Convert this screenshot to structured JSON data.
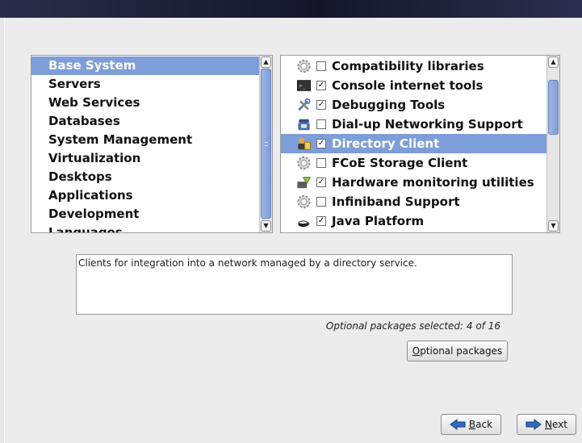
{
  "groups": {
    "items": [
      {
        "label": "Base System",
        "selected": true
      },
      {
        "label": "Servers"
      },
      {
        "label": "Web Services"
      },
      {
        "label": "Databases"
      },
      {
        "label": "System Management"
      },
      {
        "label": "Virtualization"
      },
      {
        "label": "Desktops"
      },
      {
        "label": "Applications"
      },
      {
        "label": "Development"
      },
      {
        "label": "Languages"
      }
    ]
  },
  "packages": {
    "items": [
      {
        "label": "Compatibility libraries",
        "checked": false,
        "icon": "gear-icon"
      },
      {
        "label": "Console internet tools",
        "checked": true,
        "icon": "terminal-icon"
      },
      {
        "label": "Debugging Tools",
        "checked": true,
        "icon": "tools-icon"
      },
      {
        "label": "Dial-up Networking Support",
        "checked": false,
        "icon": "telephone-icon"
      },
      {
        "label": "Directory Client",
        "checked": true,
        "icon": "users-directory-icon",
        "selected": true
      },
      {
        "label": "FCoE Storage Client",
        "checked": false,
        "icon": "gear-icon"
      },
      {
        "label": "Hardware monitoring utilities",
        "checked": true,
        "icon": "hardware-monitor-icon"
      },
      {
        "label": "Infiniband Support",
        "checked": false,
        "icon": "gear-icon"
      },
      {
        "label": "Java Platform",
        "checked": true,
        "icon": "coffee-cup-icon"
      }
    ]
  },
  "description": "Clients for integration into a network managed by a directory service.",
  "selection_summary": "Optional packages selected: 4 of 16",
  "buttons": {
    "optional_packages": {
      "pre": "",
      "mnemonic": "O",
      "post": "ptional packages"
    },
    "back": {
      "pre": "",
      "mnemonic": "B",
      "post": "ack"
    },
    "next": {
      "pre": "",
      "mnemonic": "N",
      "post": "ext"
    }
  },
  "colors": {
    "selection": "#7d9ed8",
    "banner": "#1a1c30"
  }
}
